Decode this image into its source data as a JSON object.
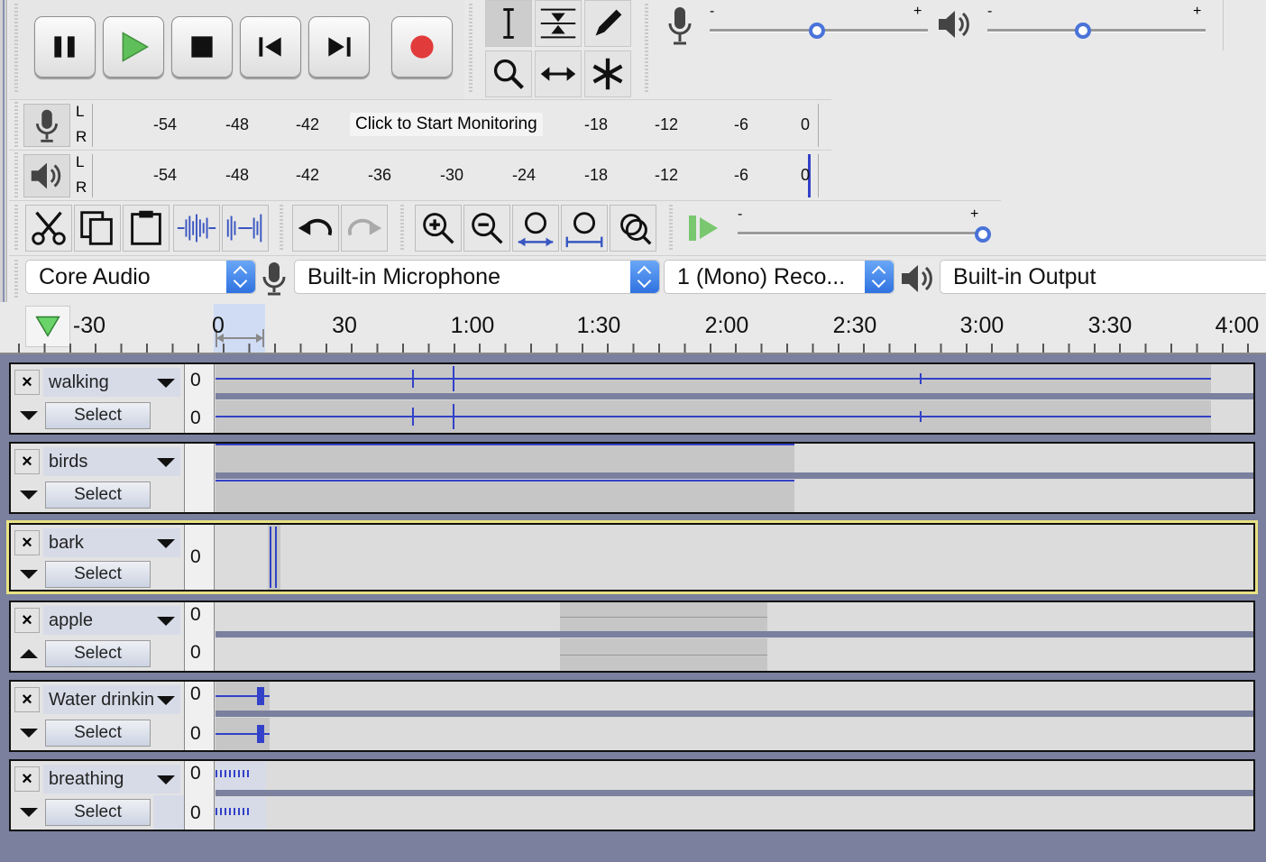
{
  "meters": {
    "record": {
      "tooltip": "Click to Start Monitoring",
      "ticks": [
        "-54",
        "-48",
        "-42",
        "-18",
        "-12",
        "-6",
        "0"
      ],
      "channels": [
        "L",
        "R"
      ]
    },
    "playback": {
      "ticks": [
        "-54",
        "-48",
        "-42",
        "-36",
        "-30",
        "-24",
        "-18",
        "-12",
        "-6",
        "0"
      ],
      "channels": [
        "L",
        "R"
      ]
    }
  },
  "sliders": {
    "plus": "+",
    "minus": "-"
  },
  "devices": {
    "host": "Core Audio",
    "input": "Built-in Microphone",
    "channels": "1 (Mono) Reco...",
    "output": "Built-in Output"
  },
  "timeline": {
    "labels": [
      "-30",
      "0",
      "30",
      "1:00",
      "1:30",
      "2:00",
      "2:30",
      "3:00",
      "3:30",
      "4:00"
    ]
  },
  "track_defaults": {
    "close": "×",
    "select": "Select",
    "zero": "0"
  },
  "tracks": [
    {
      "name": "walking"
    },
    {
      "name": "birds"
    },
    {
      "name": "bark"
    },
    {
      "name": "apple"
    },
    {
      "name": "Water drinkin"
    },
    {
      "name": "breathing"
    }
  ],
  "colors": {
    "waveform": "#3241c8",
    "focus": "#e8e184",
    "track_bg": "#7a809e",
    "record": "#e23b3b",
    "play": "#47b14a"
  },
  "icons": [
    "pause-icon",
    "play-icon",
    "stop-icon",
    "skip-start-icon",
    "skip-end-icon",
    "record-icon",
    "selection-tool-icon",
    "envelope-tool-icon",
    "draw-tool-icon",
    "zoom-tool-icon",
    "timeshift-tool-icon",
    "multi-tool-icon",
    "microphone-icon",
    "speaker-icon",
    "cut-icon",
    "copy-icon",
    "paste-icon",
    "trim-icon",
    "silence-icon",
    "undo-icon",
    "redo-icon",
    "zoom-in-icon",
    "zoom-out-icon",
    "fit-selection-icon",
    "fit-project-icon",
    "zoom-toggle-icon",
    "play-at-speed-icon"
  ]
}
